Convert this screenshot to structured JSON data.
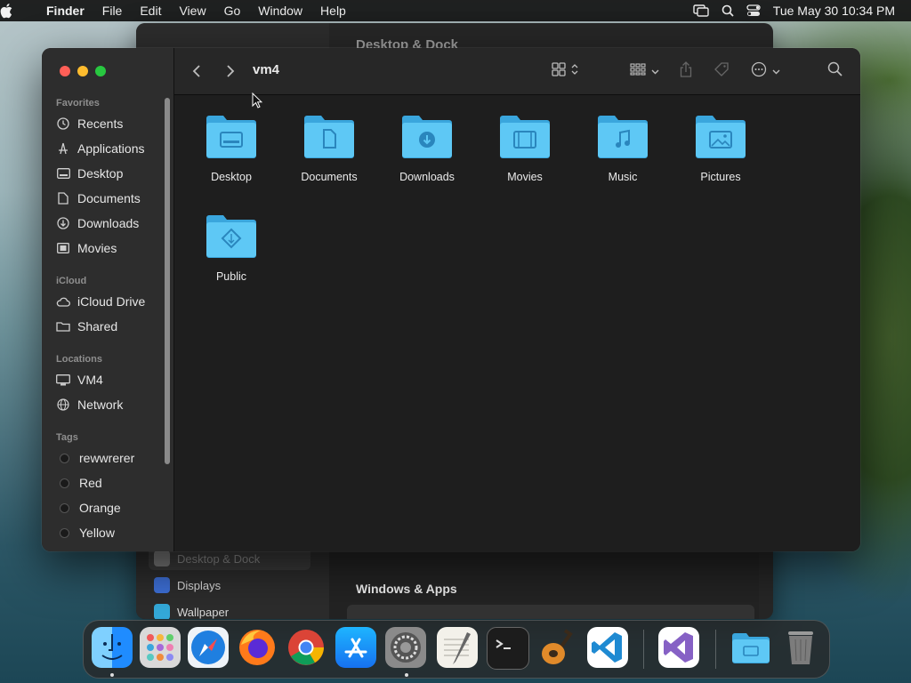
{
  "menubar": {
    "app_name": "Finder",
    "menus": [
      "File",
      "Edit",
      "View",
      "Go",
      "Window",
      "Help"
    ],
    "datetime": "Tue May 30  10:34 PM"
  },
  "background_window": {
    "title": "Desktop & Dock",
    "sidebar_items": [
      {
        "label": "Desktop & Dock",
        "icon": "dock-icon"
      },
      {
        "label": "Displays",
        "icon": "display-icon"
      },
      {
        "label": "Wallpaper",
        "icon": "wallpaper-icon"
      }
    ],
    "section_title": "Windows & Apps"
  },
  "finder": {
    "title": "vm4",
    "sidebar": {
      "favorites_header": "Favorites",
      "favorites": [
        {
          "label": "Recents",
          "icon": "clock-icon"
        },
        {
          "label": "Applications",
          "icon": "applications-icon"
        },
        {
          "label": "Desktop",
          "icon": "desktop-icon"
        },
        {
          "label": "Documents",
          "icon": "document-icon"
        },
        {
          "label": "Downloads",
          "icon": "download-icon"
        },
        {
          "label": "Movies",
          "icon": "film-icon"
        }
      ],
      "icloud_header": "iCloud",
      "icloud": [
        {
          "label": "iCloud Drive",
          "icon": "cloud-icon"
        },
        {
          "label": "Shared",
          "icon": "shared-folder-icon"
        }
      ],
      "locations_header": "Locations",
      "locations": [
        {
          "label": "VM4",
          "icon": "computer-icon"
        },
        {
          "label": "Network",
          "icon": "globe-icon"
        }
      ],
      "tags_header": "Tags",
      "tags": [
        {
          "label": "rewwrerer",
          "color": "#1a1a1a"
        },
        {
          "label": "Red",
          "color": "#1a1a1a"
        },
        {
          "label": "Orange",
          "color": "#1a1a1a"
        },
        {
          "label": "Yellow",
          "color": "#1a1a1a"
        }
      ]
    },
    "folders": [
      {
        "label": "Desktop",
        "glyph": "desktop"
      },
      {
        "label": "Documents",
        "glyph": "document"
      },
      {
        "label": "Downloads",
        "glyph": "download"
      },
      {
        "label": "Movies",
        "glyph": "film"
      },
      {
        "label": "Music",
        "glyph": "music"
      },
      {
        "label": "Pictures",
        "glyph": "picture"
      },
      {
        "label": "Public",
        "glyph": "public"
      }
    ]
  },
  "dock": {
    "apps": [
      "Finder",
      "Launchpad",
      "Safari",
      "Firefox",
      "Chrome",
      "App Store",
      "System Settings",
      "TextEdit",
      "Terminal",
      "GarageBand",
      "Visual Studio Code",
      "Visual Studio",
      "Downloads",
      "Trash"
    ]
  },
  "colors": {
    "folder_blue": "#5ec8f5",
    "folder_blue_dark": "#3aa6dd",
    "accent": "#0a84ff"
  }
}
